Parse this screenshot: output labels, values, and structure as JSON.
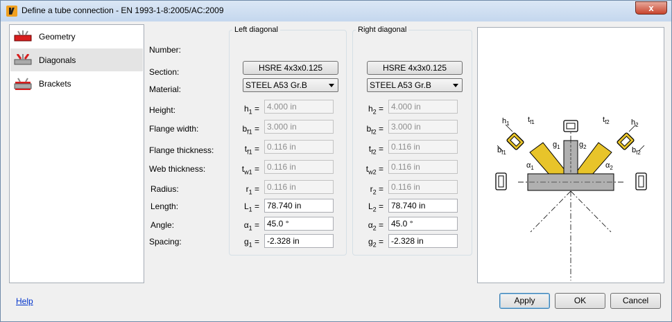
{
  "window": {
    "title": "Define a tube connection - EN 1993-1-8:2005/AC:2009",
    "close_label": "x"
  },
  "sidebar": {
    "items": [
      {
        "label": "Geometry"
      },
      {
        "label": "Diagonals"
      },
      {
        "label": "Brackets"
      }
    ]
  },
  "form": {
    "row_labels": {
      "number": "Number:",
      "section": "Section:",
      "material": "Material:",
      "height": "Height:",
      "flange_width": "Flange width:",
      "flange_thickness": "Flange thickness:",
      "web_thickness": "Web thickness:",
      "radius": "Radius:",
      "length": "Length:",
      "angle": "Angle:",
      "spacing": "Spacing:"
    },
    "left": {
      "title": "Left diagonal",
      "section": "HSRE 4x3x0.125",
      "material": "STEEL A53 Gr.B",
      "symbols": {
        "h": {
          "base": "h",
          "sub": "1"
        },
        "bf": {
          "base": "b",
          "sub": "f1"
        },
        "tf": {
          "base": "t",
          "sub": "f1"
        },
        "tw": {
          "base": "t",
          "sub": "w1"
        },
        "r": {
          "base": "r",
          "sub": "1"
        },
        "L": {
          "base": "L",
          "sub": "1"
        },
        "alpha": {
          "base": "α",
          "sub": "1"
        },
        "g": {
          "base": "g",
          "sub": "1"
        }
      },
      "values": {
        "height": "4.000 in",
        "flange_width": "3.000 in",
        "flange_thickness": "0.116 in",
        "web_thickness": "0.116 in",
        "radius": "0.116 in",
        "length": "78.740 in",
        "angle": "45.0 °",
        "spacing": "-2.328 in"
      }
    },
    "right": {
      "title": "Right diagonal",
      "section": "HSRE 4x3x0.125",
      "material": "STEEL A53 Gr.B",
      "symbols": {
        "h": {
          "base": "h",
          "sub": "2"
        },
        "bf": {
          "base": "b",
          "sub": "f2"
        },
        "tf": {
          "base": "t",
          "sub": "f2"
        },
        "tw": {
          "base": "t",
          "sub": "w2"
        },
        "r": {
          "base": "r",
          "sub": "2"
        },
        "L": {
          "base": "L",
          "sub": "2"
        },
        "alpha": {
          "base": "α",
          "sub": "2"
        },
        "g": {
          "base": "g",
          "sub": "2"
        }
      },
      "values": {
        "height": "4.000 in",
        "flange_width": "3.000 in",
        "flange_thickness": "0.116 in",
        "web_thickness": "0.116 in",
        "radius": "0.116 in",
        "length": "78.740 in",
        "angle": "45.0 °",
        "spacing": "-2.328 in"
      }
    }
  },
  "diagram": {
    "labels": {
      "h1": "h",
      "h1_sub": "1",
      "tf1": "t",
      "tf1_sub": "f1",
      "bf1": "b",
      "bf1_sub": "f1",
      "g1": "g",
      "g1_sub": "1",
      "g2": "g",
      "g2_sub": "2",
      "a1": "α",
      "a1_sub": "1",
      "a2": "α",
      "a2_sub": "2",
      "tf2": "t",
      "tf2_sub": "f2",
      "h2": "h",
      "h2_sub": "2",
      "bf2": "b",
      "bf2_sub": "f2"
    },
    "colors": {
      "diagonal": "#e8c42a",
      "chord": "#b0b0b0"
    }
  },
  "footer": {
    "help": "Help",
    "apply": "Apply",
    "ok": "OK",
    "cancel": "Cancel"
  }
}
